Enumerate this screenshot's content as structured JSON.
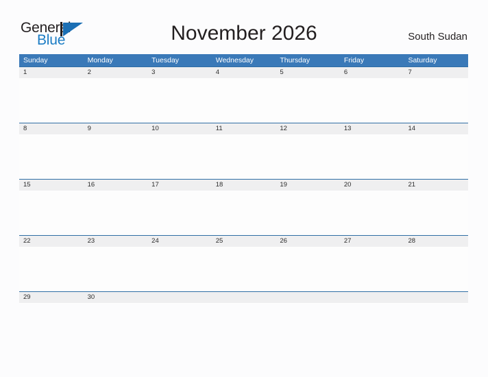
{
  "brand": {
    "name_part1": "General",
    "name_part2": "Blue",
    "mark": "triangle-logo"
  },
  "header": {
    "title": "November 2026",
    "country": "South Sudan"
  },
  "colors": {
    "header_blue": "#3a79b8",
    "row_divider_blue": "#2e6da4",
    "date_strip_gray": "#efeff0",
    "logo_blue": "#1b7cc4",
    "text_dark": "#231f20",
    "page_background": "#fcfcfd"
  },
  "calendar": {
    "month": "November",
    "year": "2026",
    "weekdays": [
      "Sunday",
      "Monday",
      "Tuesday",
      "Wednesday",
      "Thursday",
      "Friday",
      "Saturday"
    ],
    "weeks": [
      [
        "1",
        "2",
        "3",
        "4",
        "5",
        "6",
        "7"
      ],
      [
        "8",
        "9",
        "10",
        "11",
        "12",
        "13",
        "14"
      ],
      [
        "15",
        "16",
        "17",
        "18",
        "19",
        "20",
        "21"
      ],
      [
        "22",
        "23",
        "24",
        "25",
        "26",
        "27",
        "28"
      ],
      [
        "29",
        "30",
        "",
        "",
        "",
        "",
        ""
      ]
    ]
  }
}
